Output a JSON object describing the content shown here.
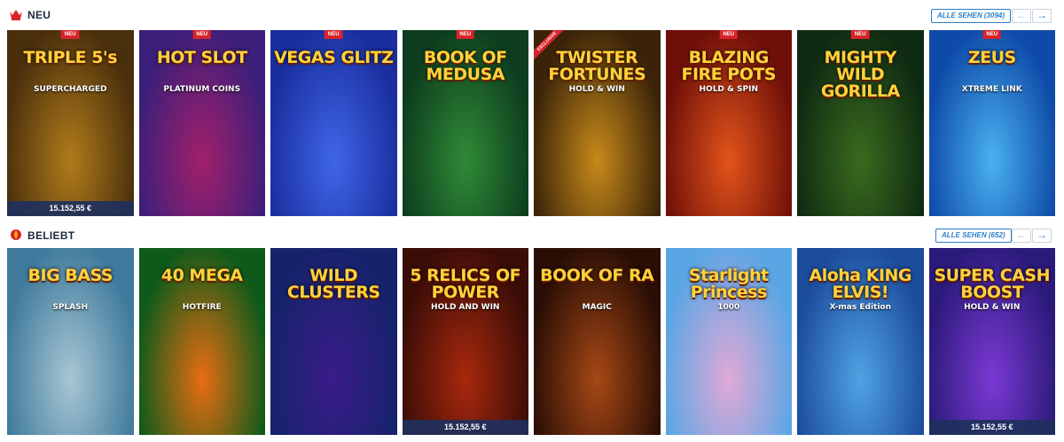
{
  "sections": [
    {
      "title": "NEU",
      "icon": "crown-icon",
      "see_all": "ALLE SEHEN (3094)",
      "prev": "←",
      "next": "→",
      "games": [
        {
          "name": "TRIPLE 5's",
          "sub": "SUPERCHARGED",
          "badge": "NEU",
          "jackpot": "15.152,55 €",
          "bg": [
            "#4a2f0c",
            "#b07b1b"
          ]
        },
        {
          "name": "HOT SLOT",
          "sub": "PLATINUM COINS",
          "badge": "NEU",
          "bg": [
            "#3b1f7a",
            "#a21f6b"
          ]
        },
        {
          "name": "VEGAS GLITZ",
          "sub": "",
          "badge": "NEU",
          "bg": [
            "#1a2e9e",
            "#3f66e8"
          ]
        },
        {
          "name": "BOOK OF MEDUSA",
          "sub": "",
          "badge": "NEU",
          "bg": [
            "#0d3d1e",
            "#2f8a36"
          ]
        },
        {
          "name": "TWISTER FORTUNES",
          "sub": "HOLD & WIN",
          "excl": "EXCLUSIVE",
          "bg": [
            "#3a2308",
            "#c78a1a"
          ]
        },
        {
          "name": "BLAZING FIRE POTS",
          "sub": "HOLD & SPIN",
          "badge": "NEU",
          "bg": [
            "#6e0f08",
            "#e2541b"
          ]
        },
        {
          "name": "MIGHTY WILD GORILLA",
          "sub": "",
          "badge": "NEU",
          "bg": [
            "#0f2a12",
            "#3a6b1e"
          ]
        },
        {
          "name": "ZEUS",
          "sub": "XTREME LINK",
          "badge": "NEU",
          "bg": [
            "#0e4aa8",
            "#49b1f0"
          ]
        }
      ]
    },
    {
      "title": "BELIEBT",
      "icon": "flame-icon",
      "see_all": "ALLE SEHEN (652)",
      "prev": "←",
      "next": "→",
      "games": [
        {
          "name": "BIG BASS",
          "sub": "SPLASH",
          "bg": [
            "#3f7a9c",
            "#a8c6d3"
          ]
        },
        {
          "name": "40 MEGA",
          "sub": "HOTFIRE",
          "bg": [
            "#0d5a1a",
            "#e86d12"
          ]
        },
        {
          "name": "WILD CLUSTERS",
          "sub": "",
          "bg": [
            "#15236a",
            "#3a1c8a"
          ]
        },
        {
          "name": "5 RELICS OF POWER",
          "sub": "HOLD AND WIN",
          "jackpot": "15.152,55 €",
          "bg": [
            "#3a0d07",
            "#a8280d"
          ]
        },
        {
          "name": "BOOK OF RA",
          "sub": "MAGIC",
          "bg": [
            "#2a0e05",
            "#a64815"
          ]
        },
        {
          "name": "Starlight Princess",
          "sub": "1000",
          "bg": [
            "#5aa6e4",
            "#e0a9d7"
          ]
        },
        {
          "name": "Aloha KING ELVIS!",
          "sub": "X-mas Edition",
          "bg": [
            "#1c4c9c",
            "#4fa3e3"
          ]
        },
        {
          "name": "SUPER CASH BOOST",
          "sub": "HOLD & WIN",
          "jackpot": "15.152,55 €",
          "bg": [
            "#2b1a7a",
            "#7b39d4"
          ]
        }
      ]
    }
  ]
}
